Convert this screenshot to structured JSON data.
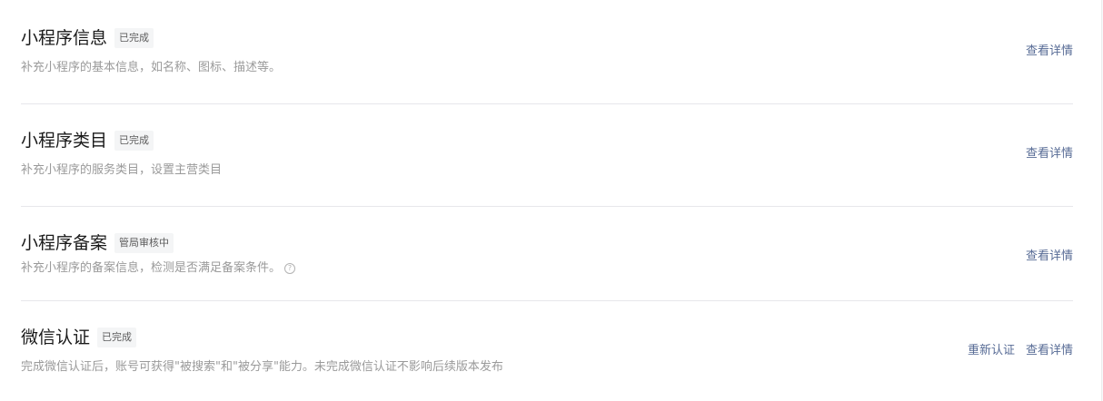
{
  "sections": [
    {
      "title": "小程序信息",
      "badge": "已完成",
      "description": "补充小程序的基本信息，如名称、图标、描述等。",
      "view_detail": "查看详情"
    },
    {
      "title": "小程序类目",
      "badge": "已完成",
      "description": "补充小程序的服务类目，设置主营类目",
      "view_detail": "查看详情"
    },
    {
      "title": "小程序备案",
      "badge": "管局审核中",
      "description": "补充小程序的备案信息，检测是否满足备案条件。",
      "help_icon": "?",
      "view_detail": "查看详情"
    },
    {
      "title": "微信认证",
      "badge": "已完成",
      "description": "完成微信认证后，账号可获得\"被搜索\"和\"被分享\"能力。未完成微信认证不影响后续版本发布",
      "reauth": "重新认证",
      "view_detail": "查看详情"
    }
  ],
  "icons": {
    "help": "question-circle-icon"
  },
  "colors": {
    "link": "#576b95",
    "title": "#1a1a1a",
    "description": "#9a9a9a",
    "badge_bg": "#f4f5f6",
    "divider": "#e7e7eb"
  }
}
